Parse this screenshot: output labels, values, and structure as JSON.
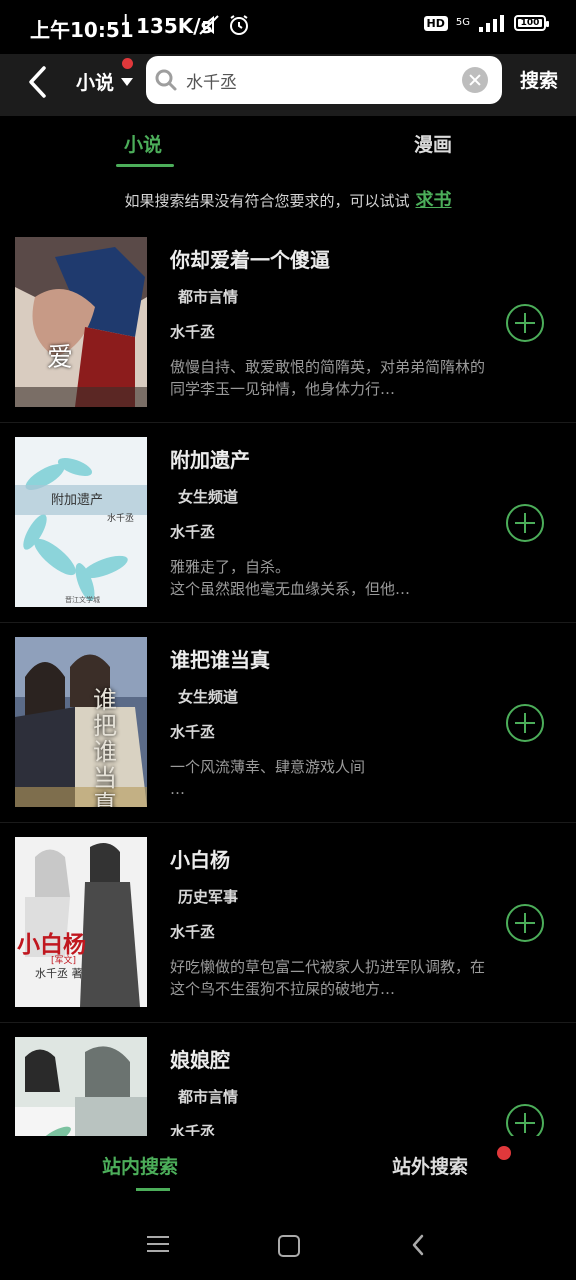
{
  "status_bar": {
    "time": "上午10:51",
    "speed": "135K/s",
    "hd": "HD",
    "network": "5G",
    "battery": "100"
  },
  "topbar": {
    "category": "小说",
    "search_value": "水千丞",
    "search_button": "搜索"
  },
  "tabs": [
    {
      "label": "小说",
      "active": true
    },
    {
      "label": "漫画",
      "active": false
    }
  ],
  "hint": {
    "text": "如果搜索结果没有符合您要求的，可以试试",
    "link": "求书"
  },
  "books": [
    {
      "title": "你却爱着一个傻逼",
      "genre": "都市言情",
      "author": "水千丞",
      "desc": "傲慢自持、敢爱敢恨的简隋英，对弟弟简隋林的同学李玉一见钟情，他身体力行…",
      "cover_text": "爱"
    },
    {
      "title": "附加遗产",
      "genre": "女生频道",
      "author": "水千丞",
      "desc": "雅雅走了，自杀。\n      这个虽然跟他毫无血缘关系，但他…",
      "cover_text": "附加遗产",
      "cover_sub": "水千丞",
      "cover_foot": "晋江文学城"
    },
    {
      "title": "谁把谁当真",
      "genre": "女生频道",
      "author": "水千丞",
      "desc": "一个风流薄幸、肆意游戏人间\n   …",
      "cover_text": "谁把谁当真"
    },
    {
      "title": "小白杨",
      "genre": "历史军事",
      "author": "水千丞",
      "desc": "好吃懒做的草包富二代被家人扔进军队调教，在这个鸟不生蛋狗不拉屎的破地方…",
      "cover_text": "小白杨",
      "cover_tag": "[军文]",
      "cover_sub": "水千丞 著"
    },
    {
      "title": "娘娘腔",
      "genre": "都市言情",
      "author": "水千丞",
      "desc": "",
      "cover_text": ""
    }
  ],
  "bottom_tabs": [
    {
      "label": "站内搜索",
      "active": true
    },
    {
      "label": "站外搜索",
      "active": false
    }
  ],
  "colors": {
    "accent": "#4cae5a",
    "badge": "#e0383b",
    "background": "#000000"
  }
}
